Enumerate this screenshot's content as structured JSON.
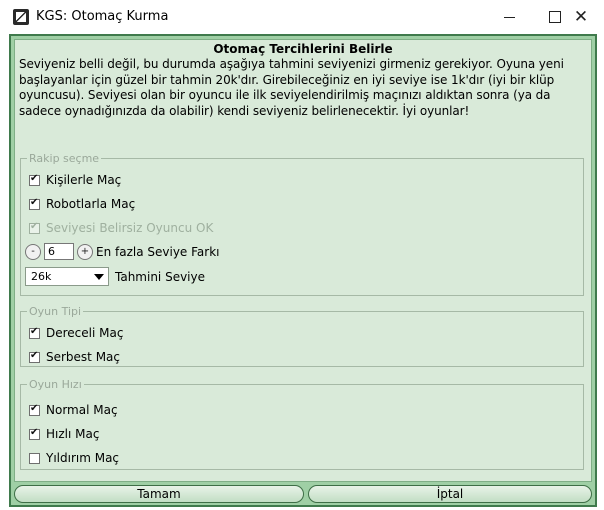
{
  "window": {
    "title": "KGS: Otomaç Kurma",
    "app_icon": "kgs-logo-icon"
  },
  "titlebar_controls": {
    "minimize": "—",
    "maximize": "□",
    "close": "✕"
  },
  "dialog": {
    "heading": "Otomaç Tercihlerini Belirle",
    "description": "Seviyeniz belli değil, bu durumda aşağıya tahmini seviyenizi girmeniz gerekiyor. Oyuna yeni başlayanlar için güzel bir tahmin 20k'dır. Girebileceğiniz en iyi seviye ise 1k'dır (iyi bir klüp oyuncusu). Seviyesi olan bir oyuncu ile ilk seviyelendirilmiş maçınızı aldıktan sonra (ya da sadece oynadığınızda da olabilir) kendi seviyeniz belirlenecektir. İyi oyunlar!"
  },
  "opponent_group": {
    "legend": "Rakip seçme",
    "humans": {
      "label": "Kişilerle Maç",
      "checked": true
    },
    "robots": {
      "label": "Robotlarla Maç",
      "checked": true
    },
    "unranked_ok": {
      "label": "Seviyesi Belirsiz Oyuncu OK",
      "checked": true,
      "disabled": true
    },
    "rank_diff": {
      "minus": "-",
      "value": "6",
      "plus": "+",
      "label": "En fazla Seviye Farkı"
    },
    "estimated_rank": {
      "value": "26k",
      "label": "Tahmini Seviye"
    }
  },
  "game_type_group": {
    "legend": "Oyun Tipi",
    "ranked": {
      "label": "Dereceli Maç",
      "checked": true
    },
    "free": {
      "label": "Serbest Maç",
      "checked": true
    }
  },
  "game_speed_group": {
    "legend": "Oyun Hızı",
    "normal": {
      "label": "Normal Maç",
      "checked": true
    },
    "fast": {
      "label": "Hızlı Maç",
      "checked": true
    },
    "blitz": {
      "label": "Yıldırım Maç",
      "checked": false
    }
  },
  "buttons": {
    "ok": "Tamam",
    "cancel": "İptal"
  },
  "colors": {
    "frame": "#9fcfa5",
    "panel": "#d9ead9",
    "border": "#3f7a4c"
  }
}
